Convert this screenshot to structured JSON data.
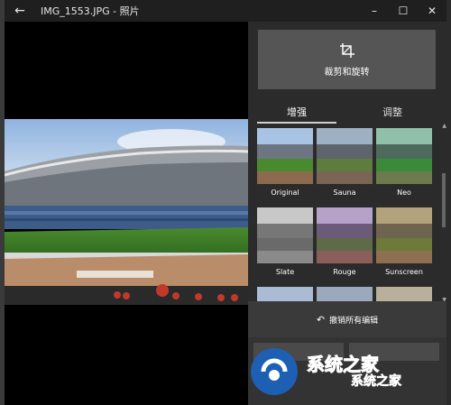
{
  "window": {
    "title": "IMG_1553.JPG - 照片",
    "back_icon": "back-arrow-icon",
    "minimize_icon": "minimize-icon",
    "maximize_icon": "maximize-icon",
    "close_icon": "close-icon"
  },
  "crop": {
    "label": "裁剪和旋转",
    "icon": "crop-icon"
  },
  "tabs": {
    "enhance": "增强",
    "adjust": "调整"
  },
  "filters": [
    {
      "label": "Original"
    },
    {
      "label": "Sauna"
    },
    {
      "label": "Neo"
    },
    {
      "label": "Slate"
    },
    {
      "label": "Rouge"
    },
    {
      "label": "Sunscreen"
    }
  ],
  "undo": {
    "label": "撤销所有编辑",
    "icon": "undo-icon"
  },
  "bottom_actions": {
    "save": "",
    "copy": ""
  },
  "watermark": {
    "line1": "系统之家",
    "line2": "系统之家"
  },
  "colors": {
    "panel_bg": "#2b2b2b",
    "button_bg": "#555555",
    "titlebar_bg": "#1f1f1f",
    "watermark_blue": "#1d5fb3"
  }
}
